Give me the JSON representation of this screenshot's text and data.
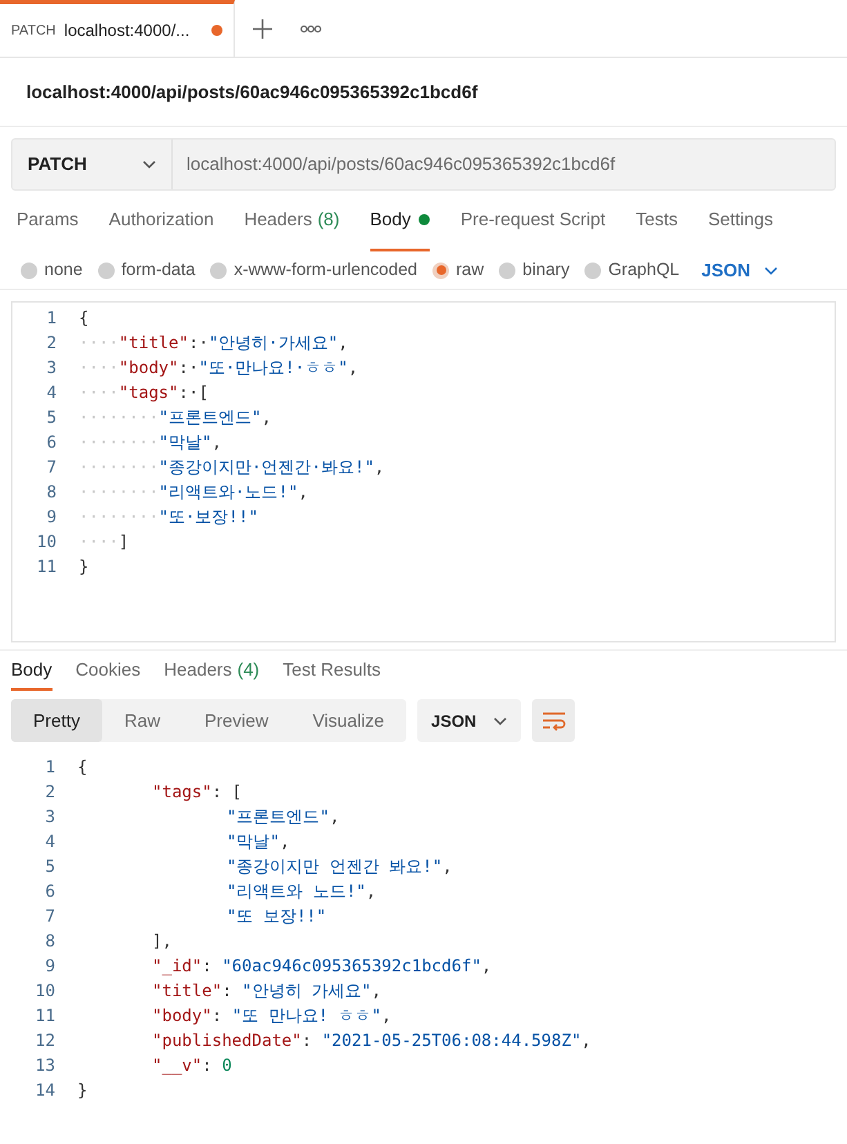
{
  "request_tabs": [
    {
      "method": "PATCH",
      "label": "localhost:4000/...",
      "unsaved": true,
      "selected": true
    }
  ],
  "request_title": "localhost:4000/api/posts/60ac946c095365392c1bcd6f",
  "method": "PATCH",
  "url": "localhost:4000/api/posts/60ac946c095365392c1bcd6f",
  "request_sections": [
    {
      "label": "Params",
      "dot": false,
      "selected": false
    },
    {
      "label": "Authorization",
      "dot": false,
      "selected": false
    },
    {
      "label": "Headers",
      "count": "(8)",
      "dot": false,
      "selected": false
    },
    {
      "label": "Body",
      "dot": true,
      "selected": true
    },
    {
      "label": "Pre-request Script",
      "dot": false,
      "selected": false
    },
    {
      "label": "Tests",
      "dot": false,
      "selected": false
    },
    {
      "label": "Settings",
      "dot": false,
      "selected": false
    }
  ],
  "body_types": [
    {
      "label": "none",
      "selected": false
    },
    {
      "label": "form-data",
      "selected": false
    },
    {
      "label": "x-www-form-urlencoded",
      "selected": false
    },
    {
      "label": "raw",
      "selected": true
    },
    {
      "label": "binary",
      "selected": false
    },
    {
      "label": "GraphQL",
      "selected": false
    }
  ],
  "body_language": "JSON",
  "request_body": [
    {
      "number": "1",
      "tokens": [
        {
          "kind": "punct",
          "text": "{"
        }
      ]
    },
    {
      "number": "2",
      "tokens": [
        {
          "kind": "ws",
          "text": "····"
        },
        {
          "kind": "key",
          "text": "\"title\""
        },
        {
          "kind": "punct",
          "text": ":·"
        },
        {
          "kind": "string",
          "text": "\"안녕히·가세요\""
        },
        {
          "kind": "punct",
          "text": ","
        }
      ]
    },
    {
      "number": "3",
      "tokens": [
        {
          "kind": "ws",
          "text": "····"
        },
        {
          "kind": "key",
          "text": "\"body\""
        },
        {
          "kind": "punct",
          "text": ":·"
        },
        {
          "kind": "string",
          "text": "\"또·만나요!·ㅎㅎ\""
        },
        {
          "kind": "punct",
          "text": ","
        }
      ]
    },
    {
      "number": "4",
      "tokens": [
        {
          "kind": "ws",
          "text": "····"
        },
        {
          "kind": "key",
          "text": "\"tags\""
        },
        {
          "kind": "punct",
          "text": ":·"
        },
        {
          "kind": "bracket",
          "text": "["
        }
      ]
    },
    {
      "number": "5",
      "tokens": [
        {
          "kind": "ws",
          "text": "········"
        },
        {
          "kind": "string",
          "text": "\"프론트엔드\""
        },
        {
          "kind": "punct",
          "text": ","
        }
      ]
    },
    {
      "number": "6",
      "tokens": [
        {
          "kind": "ws",
          "text": "········"
        },
        {
          "kind": "string",
          "text": "\"막날\""
        },
        {
          "kind": "punct",
          "text": ","
        }
      ]
    },
    {
      "number": "7",
      "tokens": [
        {
          "kind": "ws",
          "text": "········"
        },
        {
          "kind": "string",
          "text": "\"종강이지만·언젠간·봐요!\""
        },
        {
          "kind": "punct",
          "text": ","
        }
      ]
    },
    {
      "number": "8",
      "tokens": [
        {
          "kind": "ws",
          "text": "········"
        },
        {
          "kind": "string",
          "text": "\"리액트와·노드!\""
        },
        {
          "kind": "punct",
          "text": ","
        }
      ]
    },
    {
      "number": "9",
      "tokens": [
        {
          "kind": "ws",
          "text": "········"
        },
        {
          "kind": "string",
          "text": "\"또·보장!!\""
        }
      ]
    },
    {
      "number": "10",
      "tokens": [
        {
          "kind": "ws",
          "text": "····"
        },
        {
          "kind": "bracket",
          "text": "]"
        }
      ]
    },
    {
      "number": "11",
      "tokens": [
        {
          "kind": "punct",
          "text": "}"
        }
      ]
    }
  ],
  "response_sections": [
    {
      "label": "Body",
      "selected": true
    },
    {
      "label": "Cookies",
      "selected": false
    },
    {
      "label": "Headers",
      "count": "(4)",
      "selected": false
    },
    {
      "label": "Test Results",
      "selected": false
    }
  ],
  "view_modes": [
    {
      "label": "Pretty",
      "selected": true
    },
    {
      "label": "Raw",
      "selected": false
    },
    {
      "label": "Preview",
      "selected": false
    },
    {
      "label": "Visualize",
      "selected": false
    }
  ],
  "response_language": "JSON",
  "response_body": [
    {
      "number": "1",
      "tokens": [
        {
          "kind": "bracket",
          "text": "{"
        }
      ]
    },
    {
      "number": "2",
      "kind": "inner",
      "tokens": [
        {
          "kind": "key",
          "text": "\"tags\""
        },
        {
          "kind": "punct",
          "text": ": ["
        }
      ]
    },
    {
      "number": "3",
      "kind": "nested",
      "tokens": [
        {
          "kind": "string",
          "text": "\"프론트엔드\""
        },
        {
          "kind": "punct",
          "text": ","
        }
      ]
    },
    {
      "number": "4",
      "kind": "nested",
      "tokens": [
        {
          "kind": "string",
          "text": "\"막날\""
        },
        {
          "kind": "punct",
          "text": ","
        }
      ]
    },
    {
      "number": "5",
      "kind": "nested",
      "tokens": [
        {
          "kind": "string",
          "text": "\"종강이지만 언젠간 봐요!\""
        },
        {
          "kind": "punct",
          "text": ","
        }
      ]
    },
    {
      "number": "6",
      "kind": "nested",
      "tokens": [
        {
          "kind": "string",
          "text": "\"리액트와 노드!\""
        },
        {
          "kind": "punct",
          "text": ","
        }
      ]
    },
    {
      "number": "7",
      "kind": "nested",
      "tokens": [
        {
          "kind": "string",
          "text": "\"또 보장!!\""
        }
      ]
    },
    {
      "number": "8",
      "kind": "inner",
      "tokens": [
        {
          "kind": "punct",
          "text": "],"
        }
      ]
    },
    {
      "number": "9",
      "kind": "inner",
      "tokens": [
        {
          "kind": "key",
          "text": "\"_id\""
        },
        {
          "kind": "punct",
          "text": ": "
        },
        {
          "kind": "string",
          "text": "\"60ac946c095365392c1bcd6f\""
        },
        {
          "kind": "punct",
          "text": ","
        }
      ]
    },
    {
      "number": "10",
      "kind": "inner",
      "tokens": [
        {
          "kind": "key",
          "text": "\"title\""
        },
        {
          "kind": "punct",
          "text": ": "
        },
        {
          "kind": "string",
          "text": "\"안녕히 가세요\""
        },
        {
          "kind": "punct",
          "text": ","
        }
      ]
    },
    {
      "number": "11",
      "kind": "inner",
      "tokens": [
        {
          "kind": "key",
          "text": "\"body\""
        },
        {
          "kind": "punct",
          "text": ": "
        },
        {
          "kind": "string",
          "text": "\"또 만나요! ㅎㅎ\""
        },
        {
          "kind": "punct",
          "text": ","
        }
      ]
    },
    {
      "number": "12",
      "kind": "inner",
      "tokens": [
        {
          "kind": "key",
          "text": "\"publishedDate\""
        },
        {
          "kind": "punct",
          "text": ": "
        },
        {
          "kind": "string",
          "text": "\"2021-05-25T06:08:44.598Z\""
        },
        {
          "kind": "punct",
          "text": ","
        }
      ]
    },
    {
      "number": "13",
      "kind": "inner",
      "tokens": [
        {
          "kind": "key",
          "text": "\"__v\""
        },
        {
          "kind": "punct",
          "text": ": "
        },
        {
          "kind": "number",
          "text": "0"
        }
      ]
    },
    {
      "number": "14",
      "tokens": [
        {
          "kind": "bracket",
          "text": "}"
        }
      ]
    }
  ]
}
